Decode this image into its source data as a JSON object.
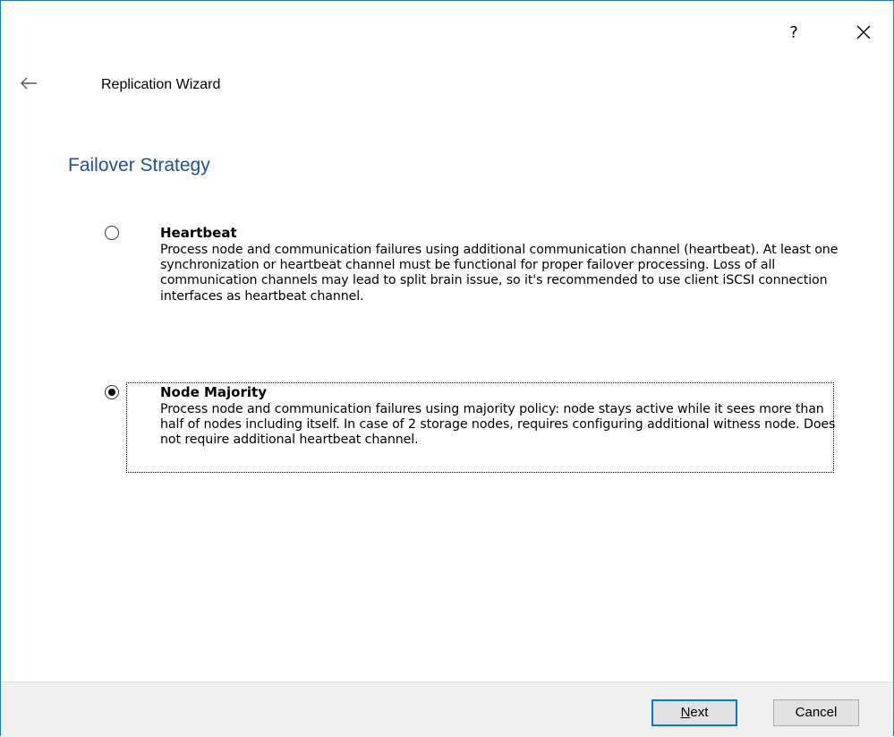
{
  "window": {
    "title": "Replication Wizard",
    "help_label": "?",
    "back_icon": "arrow-left-icon",
    "close_icon": "close-icon"
  },
  "page": {
    "heading": "Failover Strategy"
  },
  "options": [
    {
      "title": "Heartbeat",
      "description": "Process node and communication failures using additional communication channel (heartbeat). At least one synchronization or heartbeat channel must be functional for proper failover processing. Loss of all communication channels may lead to split brain issue, so it's recommended to use client iSCSI connection interfaces as heartbeat channel.",
      "selected": false
    },
    {
      "title": "Node Majority",
      "description": "Process node and communication failures using majority policy: node stays active while it sees more than half of nodes including itself. In case of 2 storage nodes, requires configuring additional witness node. Does not require additional heartbeat channel.",
      "selected": true
    }
  ],
  "footer": {
    "next_label_prefix": "N",
    "next_label_rest": "ext",
    "cancel_label": "Cancel"
  },
  "colors": {
    "border": "#1979ca",
    "heading": "#1f4e9c",
    "footer_bg": "#f0f0f0",
    "default_button_border": "#0078d7"
  }
}
